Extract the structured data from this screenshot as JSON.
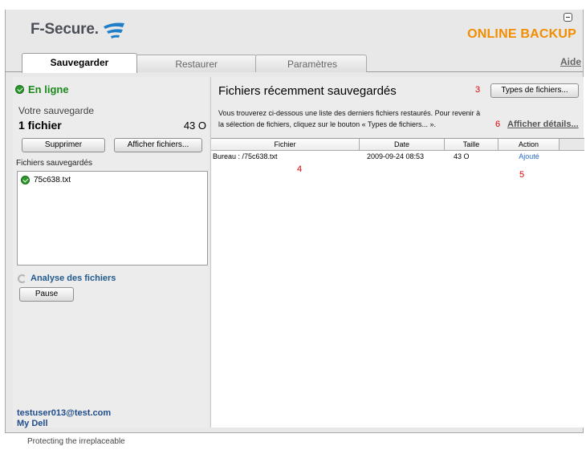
{
  "header": {
    "brand": "F-Secure.",
    "product": "ONLINE BACKUP",
    "colors": {
      "brand_text": "#4a4f58",
      "product": "#f28c00",
      "logo_blue": "#1e7fc8"
    }
  },
  "tabs": [
    {
      "label": "Sauvegarder",
      "active": true
    },
    {
      "label": "Restaurer",
      "active": false
    },
    {
      "label": "Paramètres",
      "active": false
    }
  ],
  "help_label": "Aide",
  "left": {
    "status": "En ligne",
    "backup_label": "Votre sauvegarde",
    "file_count": "1 fichier",
    "file_size": "43 O",
    "delete_button": "Supprimer",
    "show_files_button": "Afficher fichiers...",
    "saved_files_label": "Fichiers sauvegardés",
    "saved_files": [
      {
        "name": "75c638.txt",
        "icon": "green-check-icon"
      }
    ],
    "analysis_label": "Analyse des fichiers",
    "pause_button": "Pause",
    "email": "testuser013@test.com",
    "my_dell": "My Dell"
  },
  "right": {
    "title": "Fichiers récemment sauvegardés",
    "file_types_button": "Types de fichiers...",
    "description_line1": "Vous trouverez ci-dessous une liste des derniers fichiers restaurés. Pour revenir à",
    "description_line2": "la sélection de fichiers, cliquez sur le bouton « Types de fichiers... ».",
    "show_details": "Afficher détails...",
    "marker_3": "3",
    "marker_4": "4",
    "marker_5": "5",
    "marker_6": "6",
    "table": {
      "columns": [
        "Fichier",
        "Date",
        "Taille",
        "Action"
      ],
      "rows": [
        {
          "file": "Bureau : /75c638.txt",
          "date": "2009-09-24 08:53",
          "size": "43 O",
          "action": "Ajouté"
        }
      ]
    }
  },
  "footer": {
    "tagline": "Protecting the irreplaceable"
  }
}
